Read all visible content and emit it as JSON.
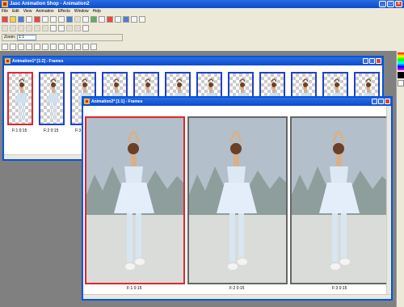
{
  "app": {
    "title": "Jasc Animation Shop - Animation2"
  },
  "menu": [
    "File",
    "Edit",
    "View",
    "Animation",
    "Effects",
    "Window",
    "Help"
  ],
  "zoom": {
    "label": "Zoom:",
    "value": "1:1"
  },
  "window1": {
    "title": "Animation1* [1:2] - Frames",
    "frames": [
      {
        "label": "F:1  0:15"
      },
      {
        "label": "F:2  0:15"
      },
      {
        "label": "F:3"
      }
    ],
    "thumb_count": 12
  },
  "window2": {
    "title": "Animation2* [1:1] - Frames",
    "frames": [
      {
        "label": "F:1  0:15"
      },
      {
        "label": "F:2  0:15"
      },
      {
        "label": "F:3  0:15"
      }
    ]
  },
  "colors": {
    "titlebar": "#0a4bd0",
    "selected_frame": "#e0262b",
    "frame_border": "#2040c8"
  }
}
